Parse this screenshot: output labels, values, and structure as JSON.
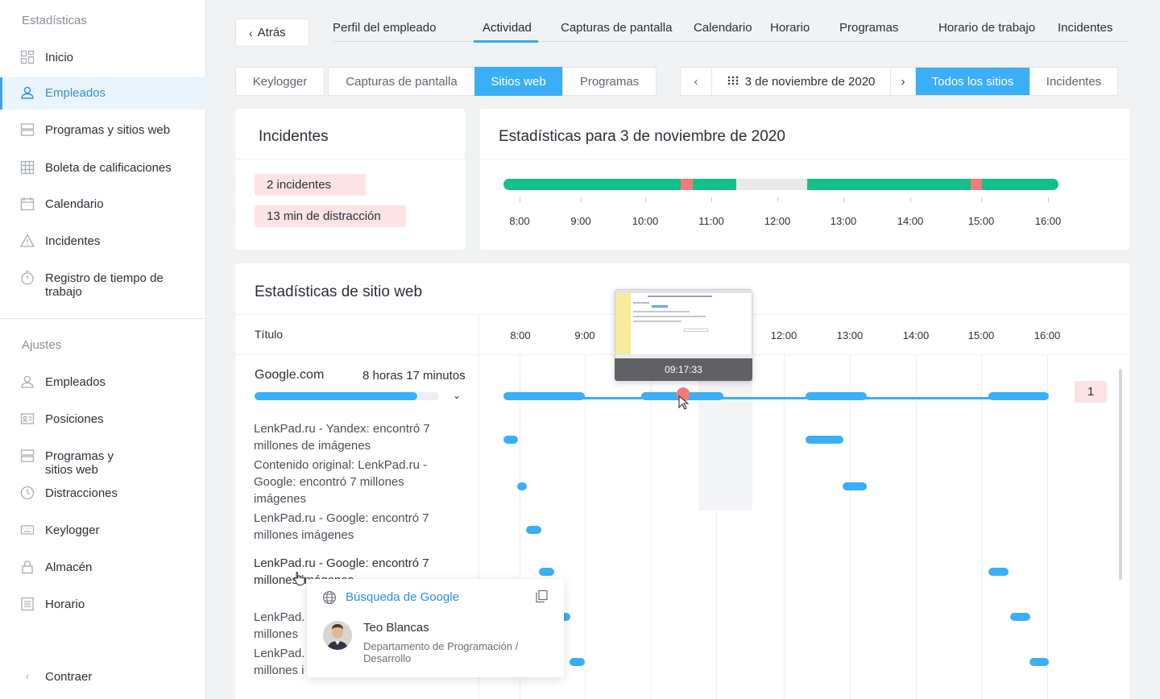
{
  "sidebar": {
    "section_stats": "Estadísticas",
    "items": [
      {
        "label": "Inicio",
        "icon": "dashboard-icon"
      },
      {
        "label": "Empleados",
        "icon": "user-icon"
      },
      {
        "label": "Programas y sitios web",
        "icon": "apps-icon"
      },
      {
        "label": "Boleta de calificaciones",
        "icon": "grid-icon"
      },
      {
        "label": "Calendario",
        "icon": "calendar-icon"
      },
      {
        "label": "Incidentes",
        "icon": "warning-icon"
      },
      {
        "label": "Registro de tiempo de trabajo",
        "icon": "stopwatch-icon"
      }
    ],
    "section_settings": "Ajustes",
    "settings_items": [
      {
        "label": "Empleados",
        "icon": "user-icon"
      },
      {
        "label": "Posiciones",
        "icon": "id-card-icon"
      },
      {
        "label": "Programas y sitios web",
        "icon": "apps-icon"
      },
      {
        "label": "Distracciones",
        "icon": "clock-icon"
      },
      {
        "label": "Keylogger",
        "icon": "keyboard-icon"
      },
      {
        "label": "Almacén",
        "icon": "lock-icon"
      },
      {
        "label": "Horario",
        "icon": "list-icon"
      }
    ],
    "collapse": "Contraer",
    "accent": "#3aa4f2"
  },
  "header": {
    "back": "Atrás",
    "tabs": [
      "Perfil del empleado",
      "Actividad",
      "Capturas de pantalla",
      "Calendario",
      "Horario",
      "Programas",
      "Horario de trabajo",
      "Incidentes"
    ],
    "active_tab": "Actividad"
  },
  "subtabs": {
    "left": [
      "Keylogger",
      "Capturas de pantalla",
      "Sitios web",
      "Programas"
    ],
    "active_left": "Sitios web",
    "date": "3 de noviembre de 2020",
    "right": [
      "Todos los sitios",
      "Incidentes"
    ],
    "active_right": "Todos los sitios"
  },
  "incidents_card": {
    "title": "Incidentes",
    "count_badge": "2 incidentes",
    "distraction_badge": "13 min de distracción"
  },
  "stats_card": {
    "title": "Estadísticas para 3 de noviembre de 2020",
    "hours": [
      "8:00",
      "9:00",
      "10:00",
      "11:00",
      "12:00",
      "13:00",
      "14:00",
      "15:00",
      "16:00"
    ],
    "colors": {
      "productive": "#14c08a",
      "incident": "#f27a7a",
      "idle": "#e9e9ea"
    }
  },
  "websites": {
    "title": "Estadísticas de sitio web",
    "col_title": "Título",
    "hours": [
      "8:00",
      "9:00",
      "12:00",
      "13:00",
      "14:00",
      "15:00",
      "16:00"
    ],
    "site": {
      "name": "Google.com",
      "duration": "8 horas 17 minutos",
      "progress": 0.88,
      "incident_count": "1"
    },
    "rows": [
      "LenkPad.ru - Yandex: encontró 7 millones de imágenes",
      "Contenido original: LenkPad.ru - Google: encontró 7 millones imágenes",
      "LenkPad.ru - Google: encontró 7 millones imágenes",
      "LenkPad.ru - Google: encontró 7 millones imágenes",
      "LenkPad.",
      "millones",
      "LenkPad.",
      "millones i"
    ],
    "screenshot_time": "09:17:33"
  },
  "popup": {
    "link": "Búsqueda de Google",
    "name": "Teo Blancas",
    "department": "Departamento de Programación / Desarrollo"
  }
}
